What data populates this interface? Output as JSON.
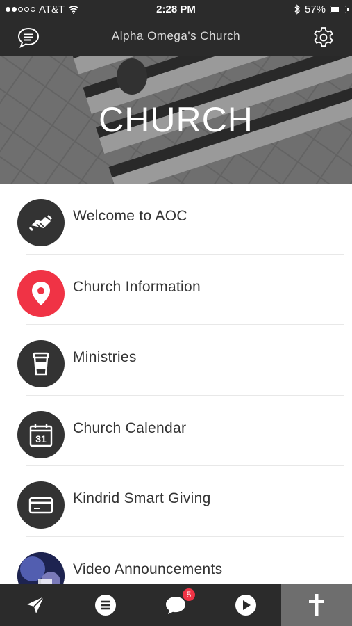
{
  "status_bar": {
    "carrier": "AT&T",
    "time": "2:28 PM",
    "battery": "57%",
    "battery_level": 0.57
  },
  "header": {
    "title": "Alpha Omega's Church",
    "left_icon": "chat-icon",
    "right_icon": "gear-icon"
  },
  "hero": {
    "title": "CHURCH"
  },
  "menu": {
    "items": [
      {
        "label": "Welcome to AOC",
        "icon": "handshake-icon"
      },
      {
        "label": "Church Information",
        "icon": "location-pin-icon"
      },
      {
        "label": "Ministries",
        "icon": "cup-icon"
      },
      {
        "label": "Church Calendar",
        "icon": "calendar-icon",
        "icon_text": "31"
      },
      {
        "label": "Kindrid Smart Giving",
        "icon": "credit-card-icon"
      },
      {
        "label": "Video Announcements",
        "icon": "video-thumbnail-icon"
      }
    ]
  },
  "tab_bar": {
    "tabs": [
      {
        "icon": "send-icon"
      },
      {
        "icon": "list-icon"
      },
      {
        "icon": "messages-icon",
        "badge": "5"
      },
      {
        "icon": "play-icon"
      },
      {
        "icon": "cross-icon",
        "active": true
      }
    ]
  },
  "colors": {
    "bar_bg": "#2b2b2b",
    "icon_bg": "#333333",
    "accent_red": "#f03345",
    "active_tab": "#6e6e6e"
  }
}
